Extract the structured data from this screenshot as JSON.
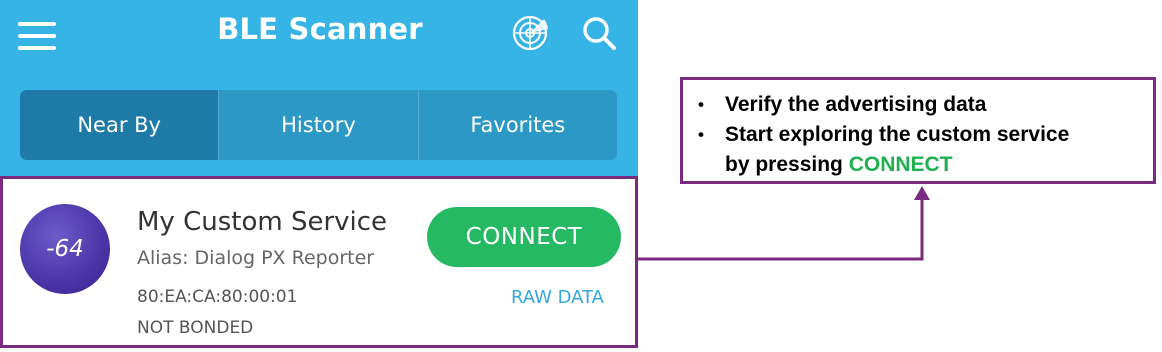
{
  "header": {
    "title": "BLE Scanner",
    "icons": [
      "menu-icon",
      "radar-icon",
      "search-icon"
    ],
    "color": "#35b4e5"
  },
  "tabs": [
    {
      "label": "Near By",
      "active": true
    },
    {
      "label": "History",
      "active": false
    },
    {
      "label": "Favorites",
      "active": false
    }
  ],
  "device": {
    "rssi": "-64",
    "name": "My Custom Service",
    "alias": "Alias: Dialog PX Reporter",
    "mac": "80:EA:CA:80:00:01",
    "bond_status": "NOT BONDED",
    "connect_label": "CONNECT",
    "raw_data_label": "RAW DATA",
    "connect_color": "#26b963"
  },
  "callout": {
    "bullet1": "Verify the advertising data",
    "bullet2_line1": "Start exploring the custom service",
    "bullet2_prefix": "by pressing ",
    "bullet2_highlight": "CONNECT",
    "border_color": "#7b2b7f",
    "highlight_color": "#1fb04f"
  }
}
